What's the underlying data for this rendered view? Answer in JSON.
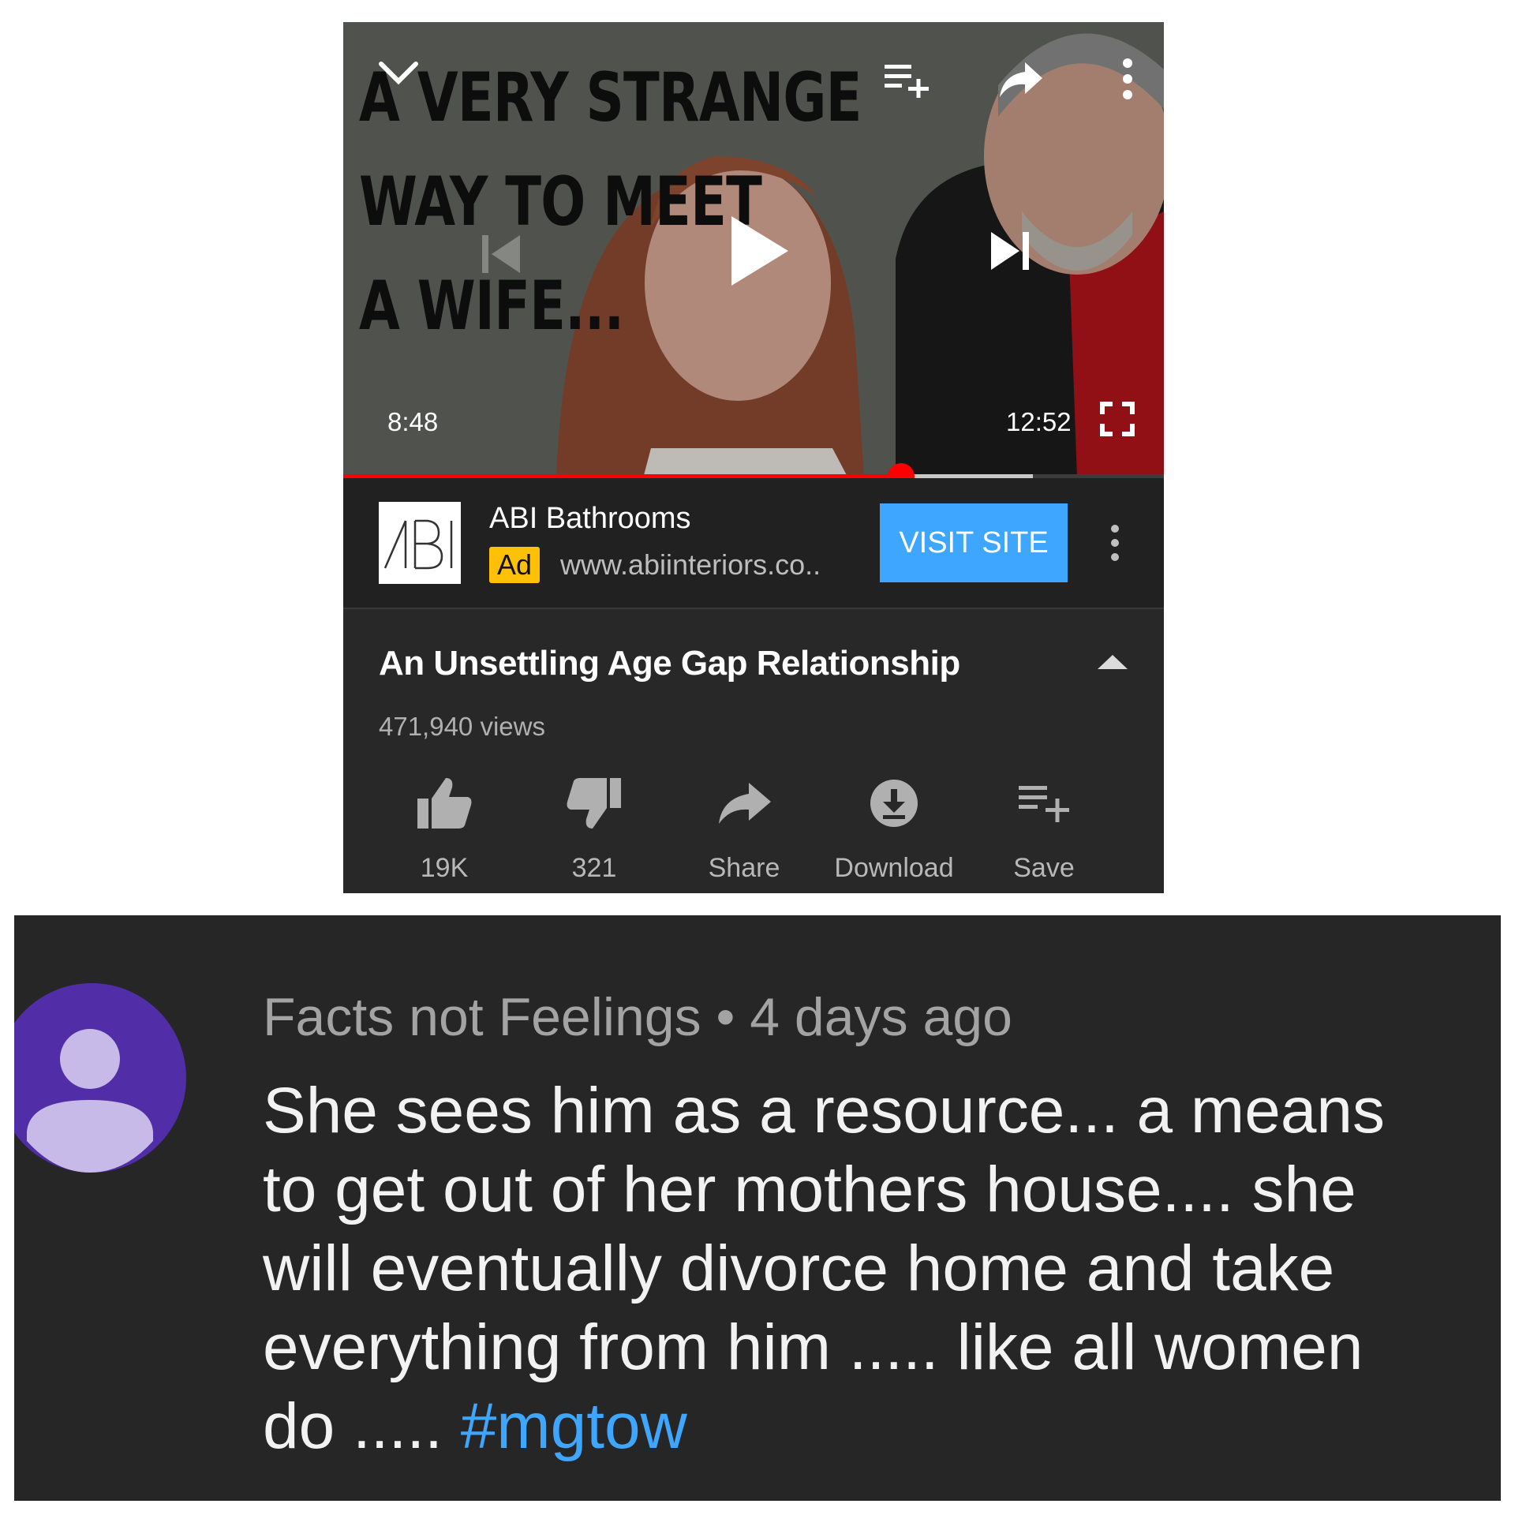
{
  "player": {
    "thumbnail_text": [
      "A VERY STRANGE",
      "WAY TO MEET",
      "A WIFE..."
    ],
    "current_time": "8:48",
    "duration": "12:52",
    "progress_played_fraction": 0.68,
    "progress_buffered_fraction": 0.84,
    "icons": [
      "chevron-down-icon",
      "add-to-queue-icon",
      "share-icon",
      "more-vert-icon",
      "previous-icon",
      "play-icon",
      "next-icon",
      "fullscreen-icon"
    ]
  },
  "ad": {
    "logo_text": "ABI",
    "advertiser": "ABI Bathrooms",
    "badge": "Ad",
    "url": "www.abiinteriors.co..",
    "cta": "VISIT SITE"
  },
  "video": {
    "title": "An Unsettling Age Gap Relationship",
    "views": "471,940 views"
  },
  "actions": [
    {
      "label": "19K",
      "icon": "thumbs-up-icon"
    },
    {
      "label": "321",
      "icon": "thumbs-down-icon"
    },
    {
      "label": "Share",
      "icon": "share-icon"
    },
    {
      "label": "Download",
      "icon": "download-icon"
    },
    {
      "label": "Save",
      "icon": "save-playlist-icon"
    }
  ],
  "comment": {
    "author": "Facts not Feelings",
    "separator": "•",
    "time": "4 days ago",
    "lines": [
      "She sees him as a resource... a means",
      "to get out of her mothers house.... she",
      "will eventually divorce home and take",
      "everything from him ..... like all women",
      "do ..... "
    ],
    "hashtag": "#mgtow"
  },
  "colors": {
    "accent_blue": "#3ea6ff",
    "progress_red": "#ff0000",
    "ad_badge": "#ffc107",
    "avatar_bg": "#512da8",
    "avatar_fg": "#c7b9e8",
    "panel_bg": "#282828",
    "comment_bg": "#262626"
  }
}
